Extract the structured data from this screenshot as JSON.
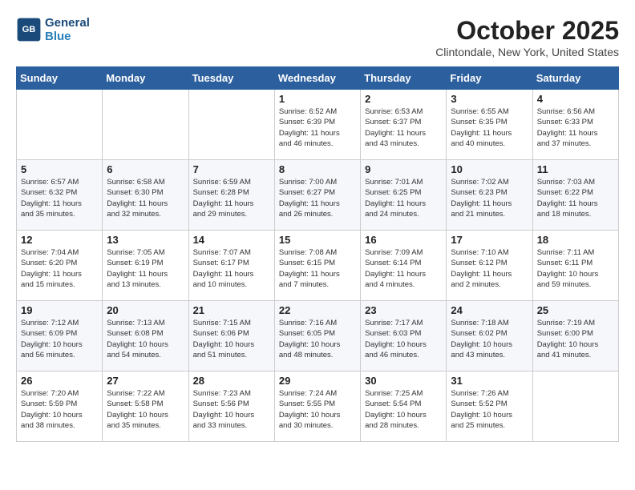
{
  "header": {
    "logo_line1": "General",
    "logo_line2": "Blue",
    "month": "October 2025",
    "location": "Clintondale, New York, United States"
  },
  "weekdays": [
    "Sunday",
    "Monday",
    "Tuesday",
    "Wednesday",
    "Thursday",
    "Friday",
    "Saturday"
  ],
  "weeks": [
    [
      {
        "day": "",
        "info": ""
      },
      {
        "day": "",
        "info": ""
      },
      {
        "day": "",
        "info": ""
      },
      {
        "day": "1",
        "info": "Sunrise: 6:52 AM\nSunset: 6:39 PM\nDaylight: 11 hours\nand 46 minutes."
      },
      {
        "day": "2",
        "info": "Sunrise: 6:53 AM\nSunset: 6:37 PM\nDaylight: 11 hours\nand 43 minutes."
      },
      {
        "day": "3",
        "info": "Sunrise: 6:55 AM\nSunset: 6:35 PM\nDaylight: 11 hours\nand 40 minutes."
      },
      {
        "day": "4",
        "info": "Sunrise: 6:56 AM\nSunset: 6:33 PM\nDaylight: 11 hours\nand 37 minutes."
      }
    ],
    [
      {
        "day": "5",
        "info": "Sunrise: 6:57 AM\nSunset: 6:32 PM\nDaylight: 11 hours\nand 35 minutes."
      },
      {
        "day": "6",
        "info": "Sunrise: 6:58 AM\nSunset: 6:30 PM\nDaylight: 11 hours\nand 32 minutes."
      },
      {
        "day": "7",
        "info": "Sunrise: 6:59 AM\nSunset: 6:28 PM\nDaylight: 11 hours\nand 29 minutes."
      },
      {
        "day": "8",
        "info": "Sunrise: 7:00 AM\nSunset: 6:27 PM\nDaylight: 11 hours\nand 26 minutes."
      },
      {
        "day": "9",
        "info": "Sunrise: 7:01 AM\nSunset: 6:25 PM\nDaylight: 11 hours\nand 24 minutes."
      },
      {
        "day": "10",
        "info": "Sunrise: 7:02 AM\nSunset: 6:23 PM\nDaylight: 11 hours\nand 21 minutes."
      },
      {
        "day": "11",
        "info": "Sunrise: 7:03 AM\nSunset: 6:22 PM\nDaylight: 11 hours\nand 18 minutes."
      }
    ],
    [
      {
        "day": "12",
        "info": "Sunrise: 7:04 AM\nSunset: 6:20 PM\nDaylight: 11 hours\nand 15 minutes."
      },
      {
        "day": "13",
        "info": "Sunrise: 7:05 AM\nSunset: 6:19 PM\nDaylight: 11 hours\nand 13 minutes."
      },
      {
        "day": "14",
        "info": "Sunrise: 7:07 AM\nSunset: 6:17 PM\nDaylight: 11 hours\nand 10 minutes."
      },
      {
        "day": "15",
        "info": "Sunrise: 7:08 AM\nSunset: 6:15 PM\nDaylight: 11 hours\nand 7 minutes."
      },
      {
        "day": "16",
        "info": "Sunrise: 7:09 AM\nSunset: 6:14 PM\nDaylight: 11 hours\nand 4 minutes."
      },
      {
        "day": "17",
        "info": "Sunrise: 7:10 AM\nSunset: 6:12 PM\nDaylight: 11 hours\nand 2 minutes."
      },
      {
        "day": "18",
        "info": "Sunrise: 7:11 AM\nSunset: 6:11 PM\nDaylight: 10 hours\nand 59 minutes."
      }
    ],
    [
      {
        "day": "19",
        "info": "Sunrise: 7:12 AM\nSunset: 6:09 PM\nDaylight: 10 hours\nand 56 minutes."
      },
      {
        "day": "20",
        "info": "Sunrise: 7:13 AM\nSunset: 6:08 PM\nDaylight: 10 hours\nand 54 minutes."
      },
      {
        "day": "21",
        "info": "Sunrise: 7:15 AM\nSunset: 6:06 PM\nDaylight: 10 hours\nand 51 minutes."
      },
      {
        "day": "22",
        "info": "Sunrise: 7:16 AM\nSunset: 6:05 PM\nDaylight: 10 hours\nand 48 minutes."
      },
      {
        "day": "23",
        "info": "Sunrise: 7:17 AM\nSunset: 6:03 PM\nDaylight: 10 hours\nand 46 minutes."
      },
      {
        "day": "24",
        "info": "Sunrise: 7:18 AM\nSunset: 6:02 PM\nDaylight: 10 hours\nand 43 minutes."
      },
      {
        "day": "25",
        "info": "Sunrise: 7:19 AM\nSunset: 6:00 PM\nDaylight: 10 hours\nand 41 minutes."
      }
    ],
    [
      {
        "day": "26",
        "info": "Sunrise: 7:20 AM\nSunset: 5:59 PM\nDaylight: 10 hours\nand 38 minutes."
      },
      {
        "day": "27",
        "info": "Sunrise: 7:22 AM\nSunset: 5:58 PM\nDaylight: 10 hours\nand 35 minutes."
      },
      {
        "day": "28",
        "info": "Sunrise: 7:23 AM\nSunset: 5:56 PM\nDaylight: 10 hours\nand 33 minutes."
      },
      {
        "day": "29",
        "info": "Sunrise: 7:24 AM\nSunset: 5:55 PM\nDaylight: 10 hours\nand 30 minutes."
      },
      {
        "day": "30",
        "info": "Sunrise: 7:25 AM\nSunset: 5:54 PM\nDaylight: 10 hours\nand 28 minutes."
      },
      {
        "day": "31",
        "info": "Sunrise: 7:26 AM\nSunset: 5:52 PM\nDaylight: 10 hours\nand 25 minutes."
      },
      {
        "day": "",
        "info": ""
      }
    ]
  ]
}
